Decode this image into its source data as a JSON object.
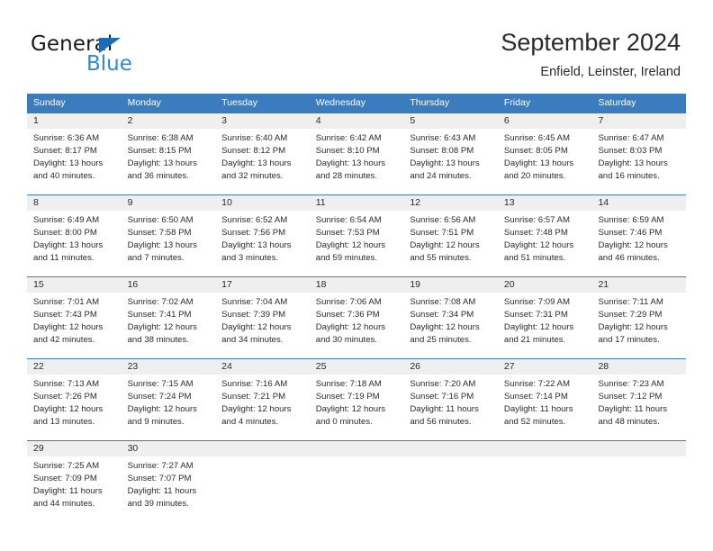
{
  "brand": {
    "name_part1": "General",
    "name_part2": "Blue",
    "flag_icon": "triangle-flag-icon"
  },
  "header": {
    "title": "September 2024",
    "location": "Enfield, Leinster, Ireland"
  },
  "colors": {
    "header_blue": "#3a7cbe",
    "brand_dark_blue": "#1c6cb5",
    "brand_light_blue": "#2f8ad4",
    "date_band_gray": "#efefef",
    "text": "#2b2b2b"
  },
  "calendar": {
    "weekday_headers": [
      "Sunday",
      "Monday",
      "Tuesday",
      "Wednesday",
      "Thursday",
      "Friday",
      "Saturday"
    ],
    "weeks": [
      {
        "numbers": [
          "1",
          "2",
          "3",
          "4",
          "5",
          "6",
          "7"
        ],
        "days": [
          {
            "sunrise": "Sunrise: 6:36 AM",
            "sunset": "Sunset: 8:17 PM",
            "daylight": "Daylight: 13 hours and 40 minutes."
          },
          {
            "sunrise": "Sunrise: 6:38 AM",
            "sunset": "Sunset: 8:15 PM",
            "daylight": "Daylight: 13 hours and 36 minutes."
          },
          {
            "sunrise": "Sunrise: 6:40 AM",
            "sunset": "Sunset: 8:12 PM",
            "daylight": "Daylight: 13 hours and 32 minutes."
          },
          {
            "sunrise": "Sunrise: 6:42 AM",
            "sunset": "Sunset: 8:10 PM",
            "daylight": "Daylight: 13 hours and 28 minutes."
          },
          {
            "sunrise": "Sunrise: 6:43 AM",
            "sunset": "Sunset: 8:08 PM",
            "daylight": "Daylight: 13 hours and 24 minutes."
          },
          {
            "sunrise": "Sunrise: 6:45 AM",
            "sunset": "Sunset: 8:05 PM",
            "daylight": "Daylight: 13 hours and 20 minutes."
          },
          {
            "sunrise": "Sunrise: 6:47 AM",
            "sunset": "Sunset: 8:03 PM",
            "daylight": "Daylight: 13 hours and 16 minutes."
          }
        ]
      },
      {
        "numbers": [
          "8",
          "9",
          "10",
          "11",
          "12",
          "13",
          "14"
        ],
        "days": [
          {
            "sunrise": "Sunrise: 6:49 AM",
            "sunset": "Sunset: 8:00 PM",
            "daylight": "Daylight: 13 hours and 11 minutes."
          },
          {
            "sunrise": "Sunrise: 6:50 AM",
            "sunset": "Sunset: 7:58 PM",
            "daylight": "Daylight: 13 hours and 7 minutes."
          },
          {
            "sunrise": "Sunrise: 6:52 AM",
            "sunset": "Sunset: 7:56 PM",
            "daylight": "Daylight: 13 hours and 3 minutes."
          },
          {
            "sunrise": "Sunrise: 6:54 AM",
            "sunset": "Sunset: 7:53 PM",
            "daylight": "Daylight: 12 hours and 59 minutes."
          },
          {
            "sunrise": "Sunrise: 6:56 AM",
            "sunset": "Sunset: 7:51 PM",
            "daylight": "Daylight: 12 hours and 55 minutes."
          },
          {
            "sunrise": "Sunrise: 6:57 AM",
            "sunset": "Sunset: 7:48 PM",
            "daylight": "Daylight: 12 hours and 51 minutes."
          },
          {
            "sunrise": "Sunrise: 6:59 AM",
            "sunset": "Sunset: 7:46 PM",
            "daylight": "Daylight: 12 hours and 46 minutes."
          }
        ]
      },
      {
        "numbers": [
          "15",
          "16",
          "17",
          "18",
          "19",
          "20",
          "21"
        ],
        "days": [
          {
            "sunrise": "Sunrise: 7:01 AM",
            "sunset": "Sunset: 7:43 PM",
            "daylight": "Daylight: 12 hours and 42 minutes."
          },
          {
            "sunrise": "Sunrise: 7:02 AM",
            "sunset": "Sunset: 7:41 PM",
            "daylight": "Daylight: 12 hours and 38 minutes."
          },
          {
            "sunrise": "Sunrise: 7:04 AM",
            "sunset": "Sunset: 7:39 PM",
            "daylight": "Daylight: 12 hours and 34 minutes."
          },
          {
            "sunrise": "Sunrise: 7:06 AM",
            "sunset": "Sunset: 7:36 PM",
            "daylight": "Daylight: 12 hours and 30 minutes."
          },
          {
            "sunrise": "Sunrise: 7:08 AM",
            "sunset": "Sunset: 7:34 PM",
            "daylight": "Daylight: 12 hours and 25 minutes."
          },
          {
            "sunrise": "Sunrise: 7:09 AM",
            "sunset": "Sunset: 7:31 PM",
            "daylight": "Daylight: 12 hours and 21 minutes."
          },
          {
            "sunrise": "Sunrise: 7:11 AM",
            "sunset": "Sunset: 7:29 PM",
            "daylight": "Daylight: 12 hours and 17 minutes."
          }
        ]
      },
      {
        "numbers": [
          "22",
          "23",
          "24",
          "25",
          "26",
          "27",
          "28"
        ],
        "days": [
          {
            "sunrise": "Sunrise: 7:13 AM",
            "sunset": "Sunset: 7:26 PM",
            "daylight": "Daylight: 12 hours and 13 minutes."
          },
          {
            "sunrise": "Sunrise: 7:15 AM",
            "sunset": "Sunset: 7:24 PM",
            "daylight": "Daylight: 12 hours and 9 minutes."
          },
          {
            "sunrise": "Sunrise: 7:16 AM",
            "sunset": "Sunset: 7:21 PM",
            "daylight": "Daylight: 12 hours and 4 minutes."
          },
          {
            "sunrise": "Sunrise: 7:18 AM",
            "sunset": "Sunset: 7:19 PM",
            "daylight": "Daylight: 12 hours and 0 minutes."
          },
          {
            "sunrise": "Sunrise: 7:20 AM",
            "sunset": "Sunset: 7:16 PM",
            "daylight": "Daylight: 11 hours and 56 minutes."
          },
          {
            "sunrise": "Sunrise: 7:22 AM",
            "sunset": "Sunset: 7:14 PM",
            "daylight": "Daylight: 11 hours and 52 minutes."
          },
          {
            "sunrise": "Sunrise: 7:23 AM",
            "sunset": "Sunset: 7:12 PM",
            "daylight": "Daylight: 11 hours and 48 minutes."
          }
        ]
      },
      {
        "numbers": [
          "29",
          "30",
          "",
          "",
          "",
          "",
          ""
        ],
        "days": [
          {
            "sunrise": "Sunrise: 7:25 AM",
            "sunset": "Sunset: 7:09 PM",
            "daylight": "Daylight: 11 hours and 44 minutes."
          },
          {
            "sunrise": "Sunrise: 7:27 AM",
            "sunset": "Sunset: 7:07 PM",
            "daylight": "Daylight: 11 hours and 39 minutes."
          },
          {
            "sunrise": "",
            "sunset": "",
            "daylight": ""
          },
          {
            "sunrise": "",
            "sunset": "",
            "daylight": ""
          },
          {
            "sunrise": "",
            "sunset": "",
            "daylight": ""
          },
          {
            "sunrise": "",
            "sunset": "",
            "daylight": ""
          },
          {
            "sunrise": "",
            "sunset": "",
            "daylight": ""
          }
        ]
      }
    ]
  }
}
